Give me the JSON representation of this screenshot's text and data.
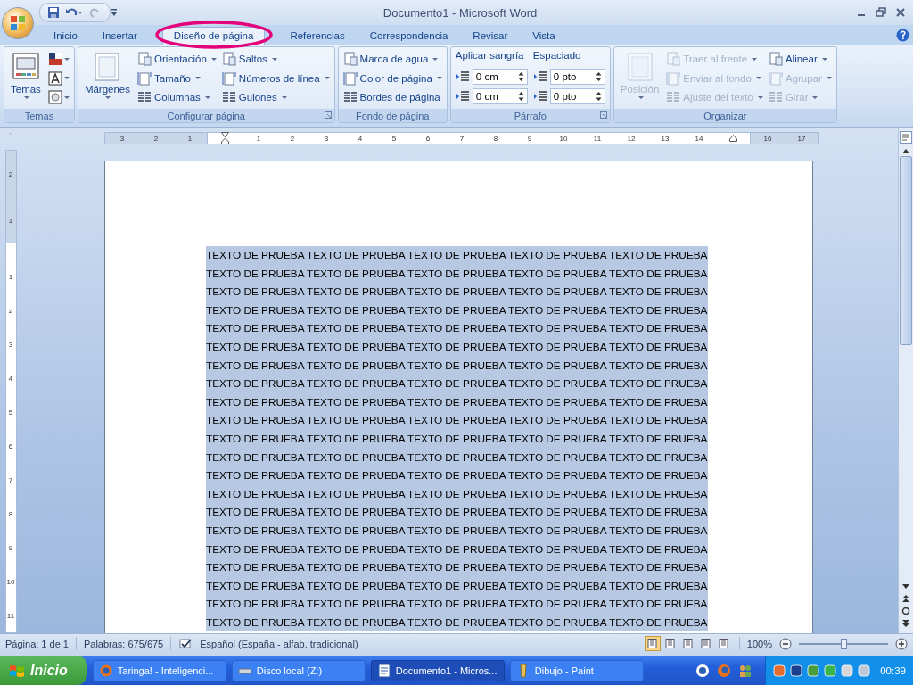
{
  "window": {
    "title": "Documento1 - Microsoft Word"
  },
  "tabs": [
    {
      "label": "Inicio",
      "selected": false,
      "circled": false
    },
    {
      "label": "Insertar",
      "selected": false,
      "circled": false
    },
    {
      "label": "Diseño de página",
      "selected": true,
      "circled": true
    },
    {
      "label": "Referencias",
      "selected": false,
      "circled": false
    },
    {
      "label": "Correspondencia",
      "selected": false,
      "circled": false
    },
    {
      "label": "Revisar",
      "selected": false,
      "circled": false
    },
    {
      "label": "Vista",
      "selected": false,
      "circled": false
    }
  ],
  "ribbon": {
    "groups": [
      {
        "label": "Temas",
        "launcher": false,
        "columns": [
          [
            {
              "kind": "large",
              "label": "Temas",
              "dropdown": true,
              "disabled": false
            }
          ],
          [
            {
              "kind": "icon",
              "dropdown": true,
              "disabled": false
            },
            {
              "kind": "icon",
              "dropdown": true,
              "disabled": false
            },
            {
              "kind": "icon",
              "dropdown": true,
              "disabled": false
            }
          ]
        ]
      },
      {
        "label": "Configurar página",
        "launcher": true,
        "columns": [
          [
            {
              "kind": "large",
              "label": "Márgenes",
              "dropdown": true,
              "disabled": false
            }
          ],
          [
            {
              "kind": "small",
              "label": "Orientación",
              "dropdown": true,
              "disabled": false
            },
            {
              "kind": "small",
              "label": "Tamaño",
              "dropdown": true,
              "disabled": false
            },
            {
              "kind": "small",
              "label": "Columnas",
              "dropdown": true,
              "disabled": false
            }
          ],
          [
            {
              "kind": "small",
              "label": "Saltos",
              "dropdown": true,
              "disabled": false
            },
            {
              "kind": "small",
              "label": "Números de línea",
              "dropdown": true,
              "disabled": false
            },
            {
              "kind": "small",
              "label": "Guiones",
              "dropdown": true,
              "disabled": false
            }
          ]
        ]
      },
      {
        "label": "Fondo de página",
        "launcher": false,
        "columns": [
          [
            {
              "kind": "small",
              "label": "Marca de agua",
              "dropdown": true,
              "disabled": false
            },
            {
              "kind": "small",
              "label": "Color de página",
              "dropdown": true,
              "disabled": false
            },
            {
              "kind": "small",
              "label": "Bordes de página",
              "dropdown": false,
              "disabled": false
            }
          ]
        ]
      },
      {
        "label": "Párrafo",
        "launcher": true,
        "columns": [
          [
            {
              "kind": "heading",
              "label": "Aplicar sangría"
            },
            {
              "kind": "spinner",
              "value": "0 cm"
            },
            {
              "kind": "spinner",
              "value": "0 cm"
            }
          ],
          [
            {
              "kind": "heading",
              "label": "Espaciado"
            },
            {
              "kind": "spinner",
              "value": "0 pto"
            },
            {
              "kind": "spinner",
              "value": "0 pto"
            }
          ]
        ]
      },
      {
        "label": "Organizar",
        "launcher": false,
        "columns": [
          [
            {
              "kind": "large",
              "label": "Posición",
              "dropdown": true,
              "disabled": true
            }
          ],
          [
            {
              "kind": "small",
              "label": "Traer al frente",
              "dropdown": true,
              "disabled": true
            },
            {
              "kind": "small",
              "label": "Enviar al fondo",
              "dropdown": true,
              "disabled": true
            },
            {
              "kind": "small",
              "label": "Ajuste del texto",
              "dropdown": true,
              "disabled": true
            }
          ],
          [
            {
              "kind": "small",
              "label": "Alinear",
              "dropdown": true,
              "disabled": false
            },
            {
              "kind": "small",
              "label": "Agrupar",
              "dropdown": true,
              "disabled": true
            },
            {
              "kind": "small",
              "label": "Girar",
              "dropdown": true,
              "disabled": true
            }
          ]
        ]
      }
    ]
  },
  "horizontal_ruler": {
    "left_labels": [
      "3",
      "2",
      "1"
    ],
    "labels": [
      "1",
      "2",
      "3",
      "4",
      "5",
      "6",
      "7",
      "8",
      "9",
      "10",
      "11",
      "12",
      "13",
      "14"
    ],
    "right_labels": [
      "16",
      "17"
    ]
  },
  "vertical_ruler": {
    "top_labels": [
      "2",
      "1"
    ],
    "labels": [
      "1",
      "2",
      "3",
      "4",
      "5",
      "6",
      "7",
      "8",
      "9",
      "10",
      "11"
    ]
  },
  "document": {
    "selected": true,
    "lines": [
      "TEXTO DE PRUEBA TEXTO DE PRUEBA TEXTO DE PRUEBA TEXTO DE PRUEBA TEXTO DE PRUEBA",
      "TEXTO DE PRUEBA TEXTO DE PRUEBA TEXTO DE PRUEBA TEXTO DE PRUEBA TEXTO DE PRUEBA",
      "TEXTO DE PRUEBA TEXTO DE PRUEBA TEXTO DE PRUEBA TEXTO DE PRUEBA TEXTO DE PRUEBA",
      "TEXTO DE PRUEBA TEXTO DE PRUEBA TEXTO DE PRUEBA TEXTO DE PRUEBA TEXTO DE PRUEBA",
      "TEXTO DE PRUEBA TEXTO DE PRUEBA TEXTO DE PRUEBA TEXTO DE PRUEBA TEXTO DE PRUEBA",
      "TEXTO DE PRUEBA TEXTO DE PRUEBA TEXTO DE PRUEBA TEXTO DE PRUEBA TEXTO DE PRUEBA",
      "TEXTO DE PRUEBA TEXTO DE PRUEBA TEXTO DE PRUEBA TEXTO DE PRUEBA TEXTO DE PRUEBA",
      "TEXTO DE PRUEBA TEXTO DE PRUEBA TEXTO DE PRUEBA TEXTO DE PRUEBA TEXTO DE PRUEBA",
      "TEXTO DE PRUEBA TEXTO DE PRUEBA TEXTO DE PRUEBA TEXTO DE PRUEBA TEXTO DE PRUEBA",
      "TEXTO DE PRUEBA TEXTO DE PRUEBA TEXTO DE PRUEBA TEXTO DE PRUEBA TEXTO DE PRUEBA",
      "TEXTO DE PRUEBA TEXTO DE PRUEBA TEXTO DE PRUEBA TEXTO DE PRUEBA TEXTO DE PRUEBA",
      "TEXTO DE PRUEBA TEXTO DE PRUEBA TEXTO DE PRUEBA TEXTO DE PRUEBA TEXTO DE PRUEBA",
      "TEXTO DE PRUEBA TEXTO DE PRUEBA TEXTO DE PRUEBA TEXTO DE PRUEBA TEXTO DE PRUEBA",
      "TEXTO DE PRUEBA TEXTO DE PRUEBA TEXTO DE PRUEBA TEXTO DE PRUEBA TEXTO DE PRUEBA",
      "TEXTO DE PRUEBA TEXTO DE PRUEBA TEXTO DE PRUEBA TEXTO DE PRUEBA TEXTO DE PRUEBA",
      "TEXTO DE PRUEBA TEXTO DE PRUEBA TEXTO DE PRUEBA TEXTO DE PRUEBA TEXTO DE PRUEBA",
      "TEXTO DE PRUEBA TEXTO DE PRUEBA TEXTO DE PRUEBA TEXTO DE PRUEBA TEXTO DE PRUEBA",
      "TEXTO DE PRUEBA TEXTO DE PRUEBA TEXTO DE PRUEBA TEXTO DE PRUEBA TEXTO DE PRUEBA",
      "TEXTO DE PRUEBA TEXTO DE PRUEBA TEXTO DE PRUEBA TEXTO DE PRUEBA TEXTO DE PRUEBA",
      "TEXTO DE PRUEBA TEXTO DE PRUEBA TEXTO DE PRUEBA TEXTO DE PRUEBA TEXTO DE PRUEBA",
      "TEXTO DE PRUEBA TEXTO DE PRUEBA TEXTO DE PRUEBA TEXTO DE PRUEBA TEXTO DE PRUEBA"
    ]
  },
  "status_bar": {
    "page": "Página: 1 de 1",
    "words": "Palabras: 675/675",
    "language": "Español (España - alfab. tradicional)",
    "views": [
      {
        "selected": true
      },
      {
        "selected": false
      },
      {
        "selected": false
      },
      {
        "selected": false
      },
      {
        "selected": false
      }
    ],
    "zoom": "100%",
    "zoom_slider": {
      "level": 0.5
    }
  },
  "taskbar": {
    "start": "Inicio",
    "tasks": [
      {
        "label": "Taringa! - Inteligenci...",
        "selected": false
      },
      {
        "label": "Disco local (Z:)",
        "selected": false
      },
      {
        "label": "Documento1 - Micros...",
        "selected": true
      },
      {
        "label": "Dibujo - Paint",
        "selected": false
      }
    ],
    "clock": "00:39"
  }
}
